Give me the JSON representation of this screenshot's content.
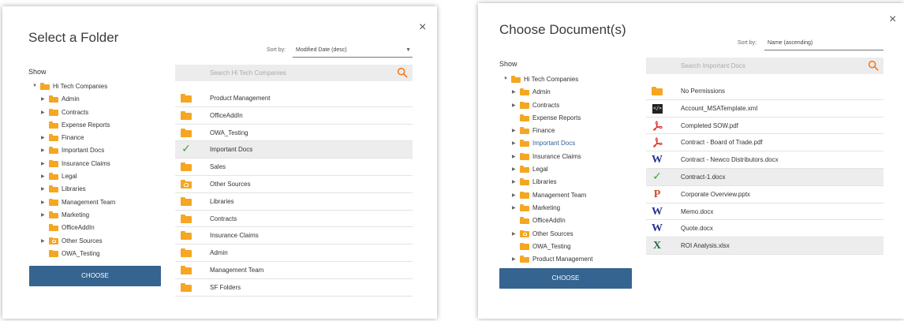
{
  "folder_dialog": {
    "title": "Select a Folder",
    "sort_label": "Sort by:",
    "sort_value": "Modified Date (desc)",
    "show_label": "Show",
    "search_placeholder": "Search Hi Tech Companies",
    "choose_label": "CHOOSE",
    "tree": [
      {
        "label": "Hi Tech Companies",
        "level": 0,
        "toggle": "expanded",
        "icon": "folder-icon"
      },
      {
        "label": "Admin",
        "level": 1,
        "toggle": "collapsed",
        "icon": "folder-icon"
      },
      {
        "label": "Contracts",
        "level": 1,
        "toggle": "collapsed",
        "icon": "folder-icon"
      },
      {
        "label": "Expense Reports",
        "level": 1,
        "toggle": "none",
        "icon": "folder-icon"
      },
      {
        "label": "Finance",
        "level": 1,
        "toggle": "collapsed",
        "icon": "folder-icon"
      },
      {
        "label": "Important Docs",
        "level": 1,
        "toggle": "collapsed",
        "icon": "folder-icon"
      },
      {
        "label": "Insurance Claims",
        "level": 1,
        "toggle": "collapsed",
        "icon": "folder-icon"
      },
      {
        "label": "Legal",
        "level": 1,
        "toggle": "collapsed",
        "icon": "folder-icon"
      },
      {
        "label": "Libraries",
        "level": 1,
        "toggle": "collapsed",
        "icon": "folder-icon"
      },
      {
        "label": "Management Team",
        "level": 1,
        "toggle": "collapsed",
        "icon": "folder-icon"
      },
      {
        "label": "Marketing",
        "level": 1,
        "toggle": "collapsed",
        "icon": "folder-icon"
      },
      {
        "label": "OfficeAddIn",
        "level": 1,
        "toggle": "none",
        "icon": "folder-icon"
      },
      {
        "label": "Other Sources",
        "level": 1,
        "toggle": "collapsed",
        "icon": "cloud-folder-icon"
      },
      {
        "label": "OWA_Testing",
        "level": 1,
        "toggle": "none",
        "icon": "folder-icon"
      }
    ],
    "items": [
      {
        "label": "Product Management",
        "icon": "folder-icon"
      },
      {
        "label": "OfficeAddIn",
        "icon": "folder-icon"
      },
      {
        "label": "OWA_Testing",
        "icon": "folder-icon"
      },
      {
        "label": "Important Docs",
        "icon": "checkmark-icon",
        "selected": true
      },
      {
        "label": "Sales",
        "icon": "folder-icon"
      },
      {
        "label": "Other Sources",
        "icon": "cloud-folder-icon"
      },
      {
        "label": "Libraries",
        "icon": "folder-icon"
      },
      {
        "label": "Contracts",
        "icon": "folder-icon"
      },
      {
        "label": "Insurance Claims",
        "icon": "folder-icon"
      },
      {
        "label": "Admin",
        "icon": "folder-icon"
      },
      {
        "label": "Management Team",
        "icon": "folder-icon"
      },
      {
        "label": "SF Folders",
        "icon": "folder-icon"
      }
    ]
  },
  "document_dialog": {
    "title": "Choose Document(s)",
    "sort_label": "Sort by:",
    "sort_value": "Name (ascending)",
    "show_label": "Show",
    "search_placeholder": "Search Important Docs",
    "choose_label": "CHOOSE",
    "tree": [
      {
        "label": "Hi Tech Companies",
        "level": 0,
        "toggle": "expanded",
        "icon": "folder-icon"
      },
      {
        "label": "Admin",
        "level": 1,
        "toggle": "collapsed",
        "icon": "folder-icon"
      },
      {
        "label": "Contracts",
        "level": 1,
        "toggle": "collapsed",
        "icon": "folder-icon"
      },
      {
        "label": "Expense Reports",
        "level": 1,
        "toggle": "none",
        "icon": "folder-icon"
      },
      {
        "label": "Finance",
        "level": 1,
        "toggle": "collapsed",
        "icon": "folder-icon"
      },
      {
        "label": "Important Docs",
        "level": 1,
        "toggle": "collapsed",
        "icon": "folder-icon",
        "active": true
      },
      {
        "label": "Insurance Claims",
        "level": 1,
        "toggle": "collapsed",
        "icon": "folder-icon"
      },
      {
        "label": "Legal",
        "level": 1,
        "toggle": "collapsed",
        "icon": "folder-icon"
      },
      {
        "label": "Libraries",
        "level": 1,
        "toggle": "collapsed",
        "icon": "folder-icon"
      },
      {
        "label": "Management Team",
        "level": 1,
        "toggle": "collapsed",
        "icon": "folder-icon"
      },
      {
        "label": "Marketing",
        "level": 1,
        "toggle": "collapsed",
        "icon": "folder-icon"
      },
      {
        "label": "OfficeAddIn",
        "level": 1,
        "toggle": "none",
        "icon": "folder-icon"
      },
      {
        "label": "Other Sources",
        "level": 1,
        "toggle": "collapsed",
        "icon": "cloud-folder-icon"
      },
      {
        "label": "OWA_Testing",
        "level": 1,
        "toggle": "none",
        "icon": "folder-icon"
      },
      {
        "label": "Product Management",
        "level": 1,
        "toggle": "collapsed",
        "icon": "folder-icon"
      }
    ],
    "items": [
      {
        "label": "No Permissions",
        "icon": "folder-icon"
      },
      {
        "label": "Account_MSATemplate.xml",
        "icon": "xml-file-icon"
      },
      {
        "label": "Completed SOW.pdf",
        "icon": "pdf-file-icon"
      },
      {
        "label": "Contract - Board of Trade.pdf",
        "icon": "pdf-file-icon"
      },
      {
        "label": "Contract - Newco Distributors.docx",
        "icon": "word-file-icon"
      },
      {
        "label": "Contract-1.docx",
        "icon": "checkmark-icon",
        "selected": true
      },
      {
        "label": "Corporate Overview.pptx",
        "icon": "powerpoint-file-icon"
      },
      {
        "label": "Memo.docx",
        "icon": "word-file-icon"
      },
      {
        "label": "Quote.docx",
        "icon": "word-file-icon"
      },
      {
        "label": "ROI Analysis.xlsx",
        "icon": "excel-file-icon",
        "selected": true
      }
    ]
  },
  "colors": {
    "folder": "#f5a623",
    "accent": "#f47b20",
    "button": "#366490",
    "selected_row": "#ededed",
    "check": "#3fa535",
    "pdf": "#e0302a",
    "word": "#2e3192",
    "powerpoint": "#d24726",
    "excel": "#1e7145"
  },
  "icons": {
    "close": "×",
    "expanded": "▼",
    "collapsed": "▶",
    "sort_caret": "▼",
    "check": "✓",
    "word": "W",
    "powerpoint": "P",
    "excel": "X",
    "xml": "</>"
  }
}
